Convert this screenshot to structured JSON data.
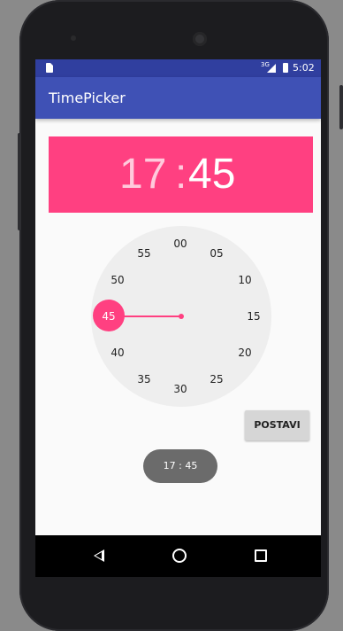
{
  "status_bar": {
    "network": "3G",
    "time": "5:02"
  },
  "app_bar": {
    "title": "TimePicker"
  },
  "time_header": {
    "hour": "17",
    "separator": ":",
    "minute": "45"
  },
  "clock": {
    "selected_minute": "45",
    "numbers": [
      "00",
      "05",
      "10",
      "15",
      "20",
      "25",
      "30",
      "35",
      "40",
      "45",
      "50",
      "55"
    ]
  },
  "actions": {
    "set_label": "POSTAVI"
  },
  "toast": {
    "text": "17 : 45"
  },
  "colors": {
    "primary": "#3f51b5",
    "primary_dark": "#303f9f",
    "accent": "#ff4081"
  },
  "icons": {
    "nav_back": "back-icon",
    "nav_home": "home-icon",
    "nav_recents": "recents-icon"
  }
}
